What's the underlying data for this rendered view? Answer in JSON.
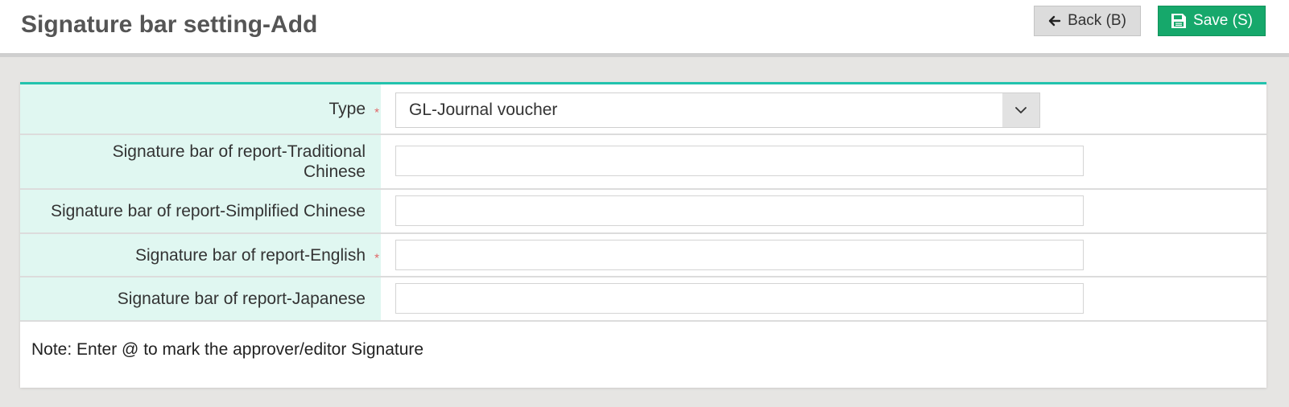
{
  "page": {
    "title": "Signature bar setting-Add"
  },
  "toolbar": {
    "back_label": "Back (B)",
    "save_label": "Save (S)"
  },
  "form": {
    "type": {
      "label": "Type",
      "required": true,
      "value": "GL-Journal voucher"
    },
    "traditional_chinese": {
      "label_line1": "Signature bar of report-Traditional",
      "label_line2": "Chinese",
      "value": ""
    },
    "simplified_chinese": {
      "label": "Signature bar of report-Simplified Chinese",
      "value": ""
    },
    "english": {
      "label": "Signature bar of report-English",
      "required": true,
      "value": ""
    },
    "japanese": {
      "label": "Signature bar of report-Japanese",
      "value": ""
    },
    "note": "Note: Enter @ to mark the approver/editor Signature",
    "required_mark": "*"
  },
  "colors": {
    "accent": "#22c3ad",
    "label_bg": "#e0f7f1",
    "save_button": "#16a86b",
    "required_mark": "#e06666"
  },
  "icons": {
    "back": "arrow-left-icon",
    "save": "floppy-disk-icon",
    "select": "chevron-down-icon"
  }
}
